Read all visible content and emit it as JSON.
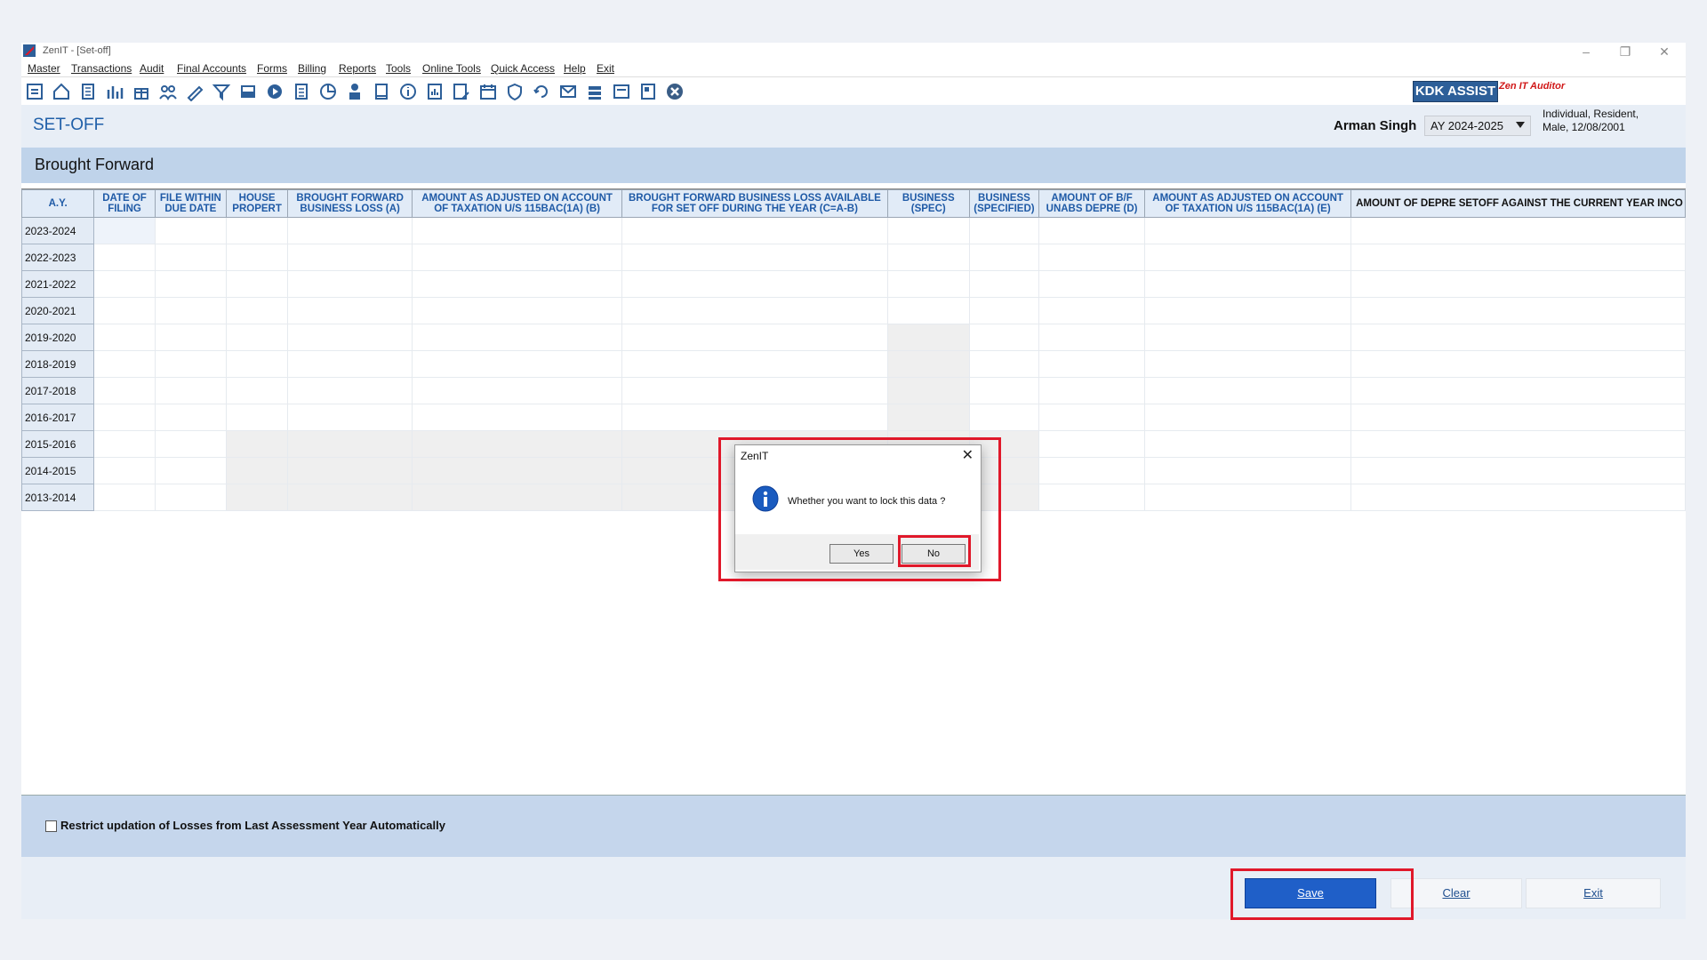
{
  "window": {
    "title": "ZenIT - [Set-off]",
    "minimize": "–",
    "restore": "❐",
    "close": "✕"
  },
  "menu": [
    "Master",
    "Transactions",
    "Audit",
    "Final Accounts",
    "Forms",
    "Billing",
    "Reports",
    "Tools",
    "Online Tools",
    "Quick Access",
    "Help",
    "Exit"
  ],
  "toolbar": {
    "icons": [
      "calculator-doc-icon",
      "home-icon",
      "building-icon",
      "bar-chart-icon",
      "gift-icon",
      "people-icon",
      "pen-icon",
      "filter-icon",
      "tax-icon",
      "disc-icon",
      "calculator-icon",
      "pie-chart-icon",
      "pay-person-icon",
      "book-icon",
      "info-icon",
      "report-icon",
      "report-edit-icon",
      "calendar-icon",
      "shield-icon",
      "refresh-doc-icon",
      "mail-icon",
      "stack-icon",
      "certificate-icon",
      "save-doc-icon",
      "close-circle-icon"
    ],
    "kdk_assist": "KDK ASSIST",
    "zen_auditor": "Zen IT Auditor"
  },
  "header": {
    "page_title": "SET-OFF",
    "client_name": "Arman Singh",
    "ay_selected": "AY 2024-2025",
    "client_info_line1": "Individual, Resident,",
    "client_info_line2": "Male, 12/08/2001"
  },
  "section": {
    "title": "Brought Forward"
  },
  "grid": {
    "columns": [
      [
        "A.Y."
      ],
      [
        "DATE OF",
        "FILING"
      ],
      [
        "FILE WITHIN",
        "DUE DATE"
      ],
      [
        "HOUSE",
        "PROPERT"
      ],
      [
        "BROUGHT FORWARD",
        "BUSINESS LOSS (A)"
      ],
      [
        "AMOUNT AS ADJUSTED ON ACCOUNT",
        "OF TAXATION U/S 115BAC(1A) (B)"
      ],
      [
        "BROUGHT FORWARD BUSINESS LOSS AVAILABLE",
        "FOR SET OFF DURING THE YEAR (C=A-B)"
      ],
      [
        "BUSINESS",
        "(SPEC)"
      ],
      [
        "BUSINESS",
        "(SPECIFIED)"
      ],
      [
        "AMOUNT OF B/F",
        "UNABS DEPRE (D)"
      ],
      [
        "AMOUNT AS ADJUSTED ON ACCOUNT",
        "OF TAXATION U/S 115BAC(1A) (E)"
      ],
      [
        "AMOUNT OF DEPRE SETOFF AGAINST THE CURRENT YEAR INCO"
      ]
    ],
    "rows": [
      "2023-2024",
      "2022-2023",
      "2021-2022",
      "2020-2021",
      "2019-2020",
      "2018-2019",
      "2017-2018",
      "2016-2017",
      "2015-2016",
      "2014-2015",
      "2013-2014"
    ]
  },
  "restrict_label": "Restrict updation of Losses from Last Assessment Year Automatically",
  "buttons": {
    "save": "Save",
    "clear": "Clear",
    "exit": "Exit"
  },
  "dialog": {
    "title": "ZenIT",
    "message": "Whether you want to lock this data ?",
    "yes": "Yes",
    "no": "No",
    "close": "✕"
  },
  "colors": {
    "accent": "#1f5fa8",
    "highlight": "#e0182a",
    "save_button": "#1f5fc8"
  }
}
